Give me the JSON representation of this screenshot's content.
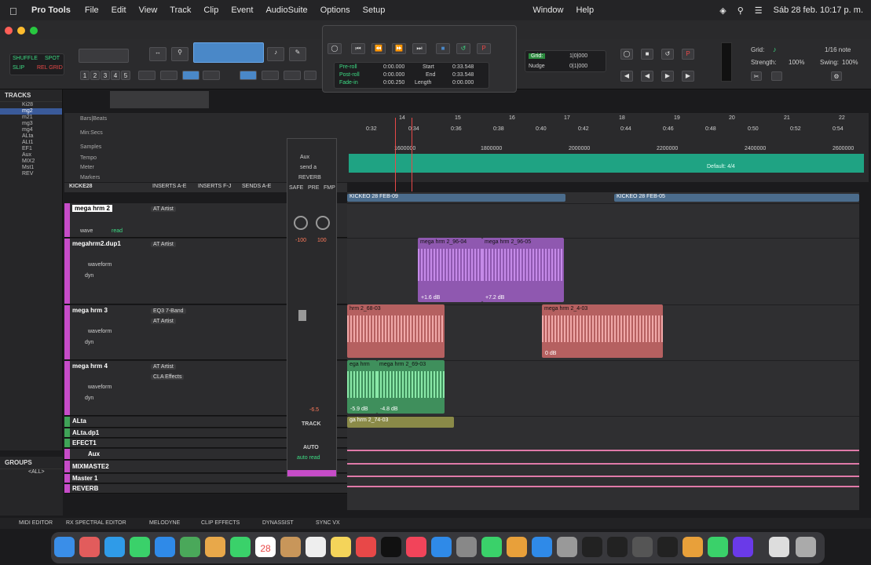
{
  "menubar": {
    "app": "Pro Tools",
    "items": [
      "File",
      "Edit",
      "View",
      "Track",
      "Clip",
      "Event",
      "AudioSuite",
      "Options",
      "Setup"
    ],
    "right_items": [
      "Window",
      "Help"
    ],
    "datetime": "Sáb 28 feb. 10:17 p. m."
  },
  "toolbar": {
    "modes": [
      "SHUFFLE",
      "SPOT",
      "SLIP",
      "REL GRID"
    ],
    "zoom_presets": [
      "1",
      "2",
      "3",
      "4",
      "5"
    ],
    "grid_label": "Grid:",
    "grid_value": "1|0|000",
    "grid_note": "1/16 note",
    "nudge_label": "Nudge",
    "nudge_value": "0|1|000",
    "strength_label": "Strength:",
    "strength_value": "100%",
    "swing_label": "Swing:",
    "swing_value": "100%"
  },
  "transport": {
    "preroll_label": "Pre-roll",
    "postroll_label": "Post-roll",
    "fadein_label": "Fade-in",
    "preroll": "0:00.000",
    "postroll": "0:00.000",
    "fadein": "0:00.250",
    "start_label": "Start",
    "end_label": "End",
    "length_label": "Length",
    "start": "0:33.548",
    "end": "0:33.548",
    "length": "0:00.000"
  },
  "tracks_panel": {
    "title": "TRACKS",
    "tracks": [
      "Ki28",
      "mg2",
      "m21",
      "mg3",
      "mg4",
      "ALta",
      "ALt1",
      "EF1",
      "Aux",
      "MIX2",
      "Mst1",
      "REV"
    ]
  },
  "groups_panel": {
    "title": "GROUPS",
    "all": "<ALL>"
  },
  "rulers": {
    "bars_label": "Bars|Beats",
    "minsecs_label": "Min:Secs",
    "samples_label": "Samples",
    "tempo_label": "Tempo",
    "meter_label": "Meter",
    "markers_label": "Markers",
    "bars": [
      "14",
      "15",
      "16",
      "17",
      "18",
      "19",
      "20",
      "21",
      "22"
    ],
    "minsecs": [
      "0:32",
      "0:34",
      "0:36",
      "0:38",
      "0:40",
      "0:42",
      "0:44",
      "0:46",
      "0:48",
      "0:50",
      "0:52",
      "0:54"
    ],
    "samples": [
      "1600000",
      "1800000",
      "2000000",
      "2200000",
      "2400000",
      "2600000"
    ],
    "meter_default": "Default: 4/4"
  },
  "mix_header": {
    "columns": [
      "INSERTS A-E",
      "INSERTS F-J",
      "SENDS A-E"
    ],
    "first_track": "KICKE28"
  },
  "tracks": [
    {
      "name": "mega hrm 2",
      "inserts": [
        "AT Artist"
      ],
      "view": "wave",
      "auto": "read"
    },
    {
      "name": "megahrm2.dup1",
      "inserts": [
        "AT Artist"
      ],
      "view": "waveform",
      "auto": "dyn"
    },
    {
      "name": "mega hrm 3",
      "inserts": [
        "EQ3 7-Band",
        "AT Artist"
      ],
      "view": "waveform",
      "auto": "dyn"
    },
    {
      "name": "mega hrm 4",
      "inserts": [
        "AT Artist",
        "CLA Effects"
      ],
      "view": "waveform",
      "auto": "dyn"
    },
    {
      "name": "ALta"
    },
    {
      "name": "ALta.dp1"
    },
    {
      "name": "EFECT1"
    },
    {
      "name": "Aux"
    },
    {
      "name": "MIXMASTE2"
    },
    {
      "name": "Master 1"
    },
    {
      "name": "REVERB"
    }
  ],
  "floating_mixer": {
    "io": "Aux",
    "send": "send a",
    "bus": "REVERB",
    "safe": "SAFE",
    "pre": "PRE",
    "fmp": "FMP",
    "pan_left": "-100",
    "pan_right": "100",
    "volume": "-6.5",
    "track_label": "TRACK",
    "auto_label": "AUTO",
    "auto_mode": "auto read"
  },
  "clips": [
    {
      "name": "KICKEO 28 FEB-09"
    },
    {
      "name": "KICKEO 28 FEB-05"
    },
    {
      "name": "mega hrm 2_96-04",
      "gain": "+1.6 dB"
    },
    {
      "name": "mega hrm 2_96-05",
      "gain": "+7.2 dB"
    },
    {
      "name": "hrm 2_68-03"
    },
    {
      "name": "mega hrm 2_4-03",
      "gain": "0 dB"
    },
    {
      "name": "ega hrm",
      "gain": "-5.9 dB"
    },
    {
      "name": "mega hrm 2_69-03",
      "gain": "-4.8 dB"
    },
    {
      "name": "ga hrm 2_74-03"
    }
  ],
  "bottombar": [
    "MIDI EDITOR",
    "RX SPECTRAL EDITOR",
    "MELODYNE",
    "CLIP EFFECTS",
    "DYNASSIST",
    "SYNC VX"
  ],
  "dock_date": "28"
}
